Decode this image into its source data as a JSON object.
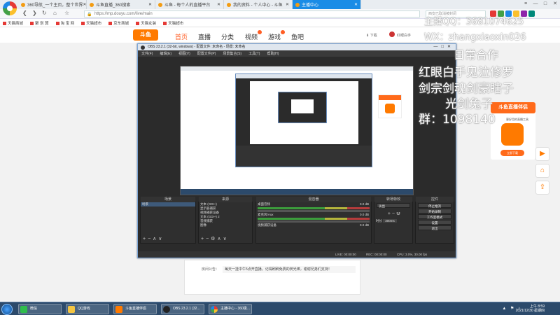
{
  "browser": {
    "tabs": [
      {
        "label": "360导航_一个主页，整个世界"
      },
      {
        "label": "斗鱼直播_360搜索"
      },
      {
        "label": "斗鱼 - 每个人的直播平台"
      },
      {
        "label": "我的资料 - 个人中心 - 斗鱼"
      },
      {
        "label": "主播中心"
      }
    ],
    "active_tab_index": 4,
    "url": "https://mp.douyu.com/live/main",
    "search_placeholder": "西安已取消被封闭",
    "nav_icons": [
      "back-icon",
      "forward-icon",
      "refresh-icon",
      "home-icon",
      "star-icon"
    ],
    "bookmarks": [
      {
        "label": "天猫商城"
      },
      {
        "label": "聚 划 算"
      },
      {
        "label": "淘 宝 网"
      },
      {
        "label": "天猫超市"
      },
      {
        "label": "京东商城"
      },
      {
        "label": "天猫女装"
      },
      {
        "label": "天猫超市"
      }
    ],
    "window_controls": [
      "≡",
      "—",
      "□",
      "✕"
    ]
  },
  "douyu": {
    "logo_text": "斗鱼",
    "nav": [
      {
        "label": "首页"
      },
      {
        "label": "直播"
      },
      {
        "label": "分类"
      },
      {
        "label": "视频"
      },
      {
        "label": "游戏"
      },
      {
        "label": "鱼吧"
      }
    ],
    "download_label": "下载",
    "user_label": "红眼白手",
    "announcement_label": "房间公告：",
    "announcement_text": "每天一挂中午5点开直播，记得刷刷免费的荧光棒，谢谢兄弟们支持！",
    "promo": {
      "title": "斗鱼直播伴侣",
      "subtitle": "更好用的直播工具",
      "button": "立即下载"
    },
    "side_buttons": [
      "▶",
      "⌂",
      "⇪"
    ]
  },
  "overlay": {
    "line1": "主播QQ：3681074625",
    "line2": "WX：zhangxiaoxin026",
    "line3": "日常合作",
    "line4": "红眼白手鬼泣修罗",
    "line5": "剑宗剑魂剑豪瞎子",
    "line6": "光剑兔子",
    "line7": "群：1098140"
  },
  "obs": {
    "title": "OBS 23.2.1 (32-bit, windows) - 配置文件: 未命名 - 场景: 未命名",
    "menu": [
      "文件(F)",
      "编辑(E)",
      "视图(V)",
      "配置文件(P)",
      "场景集合(S)",
      "工具(T)",
      "帮助(H)"
    ],
    "panels": {
      "scenes": {
        "header": "场景",
        "items": [
          "场景"
        ]
      },
      "sources": {
        "header": "来源",
        "items": [
          "文本 (GDI+)",
          "显示器捕获",
          "视频捕获设备",
          "文本 (GDI+) 2",
          "音频捕获",
          "图像"
        ]
      },
      "mixer": {
        "header": "混音器",
        "channels": [
          {
            "name": "桌面音频",
            "db": "0.0 dB"
          },
          {
            "name": "麦克风/Aux",
            "db": "0.0 dB"
          },
          {
            "name": "视频捕获设备",
            "db": "0.0 dB"
          }
        ]
      },
      "transitions": {
        "header": "转场特效",
        "type": "淡出",
        "duration_label": "时长",
        "duration": "300ms"
      },
      "controls": {
        "header": "控件",
        "buttons": [
          "停止推流",
          "开始录制",
          "工作室模式",
          "设置",
          "退出"
        ]
      }
    },
    "status": {
      "live": "LIVE: 00:00:00",
      "rec": "REC: 00:00:00",
      "cpu": "CPU: 3.0%, 30.00 fps"
    }
  },
  "taskbar": {
    "items": [
      {
        "label": "微信"
      },
      {
        "label": "QQ游戏"
      },
      {
        "label": "斗鱼直播伴侣"
      },
      {
        "label": "OBS 23.2.1 (32..."
      },
      {
        "label": "主播中心 - 360极..."
      }
    ],
    "time": "上午 8:59",
    "date": "2021/12/30 星期四"
  },
  "colors": {
    "accent": "#ff5d23",
    "douyu_orange": "#ff7a00",
    "browser_active_tab": "#1a8ce6",
    "obs_dark": "#2b2b2b",
    "taskbar": "#2c4a6b"
  }
}
